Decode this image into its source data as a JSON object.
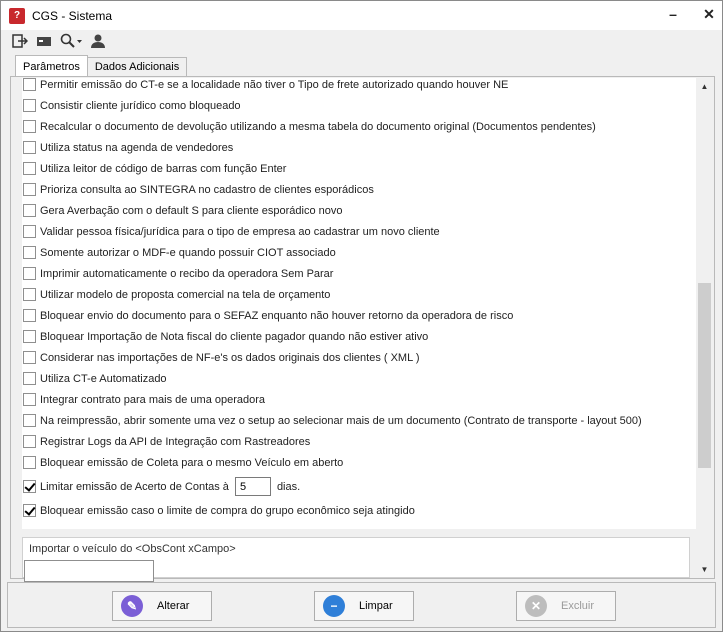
{
  "window": {
    "title": "CGS - Sistema",
    "app_icon_glyph": "?",
    "minimize": "–",
    "close": "✕"
  },
  "toolbar": {
    "icons": [
      "exit-icon",
      "card-icon",
      "search-dropdown-icon",
      "user-icon"
    ]
  },
  "tabs": [
    {
      "label": "Parâmetros",
      "active": true
    },
    {
      "label": "Dados Adicionais",
      "active": false
    }
  ],
  "options": [
    {
      "label": "Permitir emissão do CT-e se a localidade não tiver o Tipo de frete autorizado quando houver NE",
      "checked": false
    },
    {
      "label": "Consistir cliente jurídico como bloqueado",
      "checked": false
    },
    {
      "label": "Recalcular o documento de devolução utilizando a mesma tabela do documento original (Documentos pendentes)",
      "checked": false
    },
    {
      "label": "Utiliza status na agenda de vendedores",
      "checked": false
    },
    {
      "label": "Utiliza leitor de código de barras com função Enter",
      "checked": false
    },
    {
      "label": "Prioriza consulta ao SINTEGRA no cadastro de clientes esporádicos",
      "checked": false
    },
    {
      "label": "Gera Averbação com o default S para cliente esporádico novo",
      "checked": false
    },
    {
      "label": "Validar pessoa física/jurídica para o tipo de empresa ao cadastrar um novo cliente",
      "checked": false
    },
    {
      "label": "Somente autorizar o MDF-e quando possuir CIOT associado",
      "checked": false
    },
    {
      "label": "Imprimir automaticamente o recibo da operadora Sem Parar",
      "checked": false
    },
    {
      "label": "Utilizar modelo de proposta comercial na tela de orçamento",
      "checked": false
    },
    {
      "label": "Bloquear envio do documento para o SEFAZ  enquanto não houver retorno da operadora de risco",
      "checked": false
    },
    {
      "label": "Bloquear Importação de Nota fiscal do cliente pagador quando não estiver ativo",
      "checked": false
    },
    {
      "label": "Considerar nas importações de NF-e's os dados originais dos clientes ( XML )",
      "checked": false
    },
    {
      "label": "Utiliza CT-e Automatizado",
      "checked": false
    },
    {
      "label": "Integrar contrato para mais de uma operadora",
      "checked": false
    },
    {
      "label": "Na reimpressão, abrir somente uma vez o setup ao selecionar mais de um documento (Contrato de transporte - layout 500)",
      "checked": false
    },
    {
      "label": "Registrar Logs da API de Integração com Rastreadores",
      "checked": false
    },
    {
      "label": "Bloquear emissão de Coleta para o mesmo Veículo em aberto",
      "checked": false
    }
  ],
  "limit_option": {
    "label": "Limitar emissão de Acerto de Contas à",
    "value": "5",
    "suffix": "dias.",
    "checked": true
  },
  "block_option": {
    "label": "Bloquear emissão caso o limite de compra do grupo econômico seja atingido",
    "checked": true
  },
  "vehicle_group": {
    "label": "Importar o veículo do <ObsCont xCampo>",
    "value": ""
  },
  "buttons": {
    "alterar": {
      "label": "Alterar",
      "color": "#7b5fd6"
    },
    "limpar": {
      "label": "Limpar",
      "color": "#2f7fd8"
    },
    "excluir": {
      "label": "Excluir",
      "color": "#bdbdbd"
    }
  },
  "colors": {
    "highlight": "#e0161e",
    "app_icon": "#c8282d"
  }
}
